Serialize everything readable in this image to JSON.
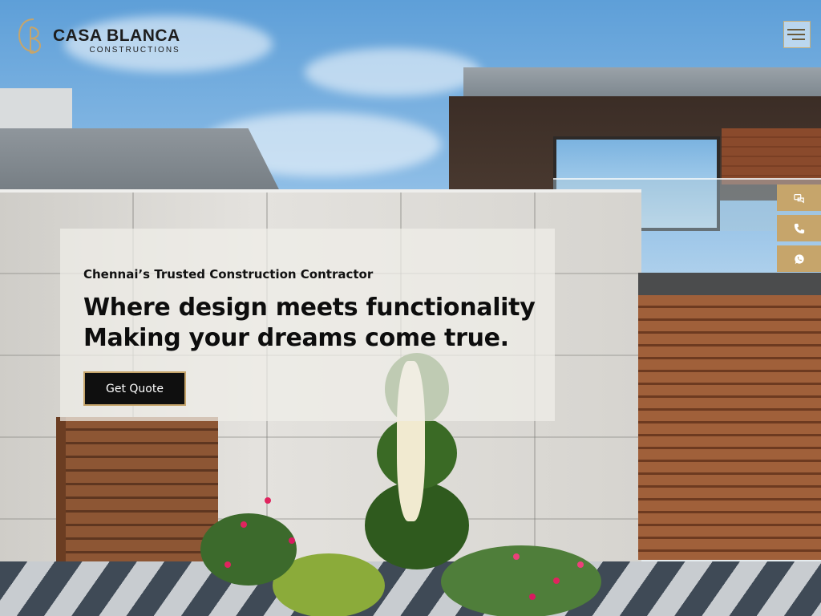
{
  "header": {
    "logo_name": "CASA BLANCA",
    "logo_sub": "CONSTRUCTIONS",
    "menu_icon": "hamburger-menu-icon"
  },
  "hero": {
    "eyebrow": "Chennai’s Trusted Construction Contractor",
    "headline_line1": "Where design meets functionality",
    "headline_line2": "Making your dreams come true.",
    "cta_label": "Get Quote"
  },
  "side_rail": {
    "items": [
      {
        "icon": "chat-icon"
      },
      {
        "icon": "phone-icon"
      },
      {
        "icon": "whatsapp-icon"
      }
    ]
  },
  "colors": {
    "accent_gold": "#c6a56b",
    "cta_background": "#0f0f0f",
    "text_dark": "#0d0d0d"
  }
}
